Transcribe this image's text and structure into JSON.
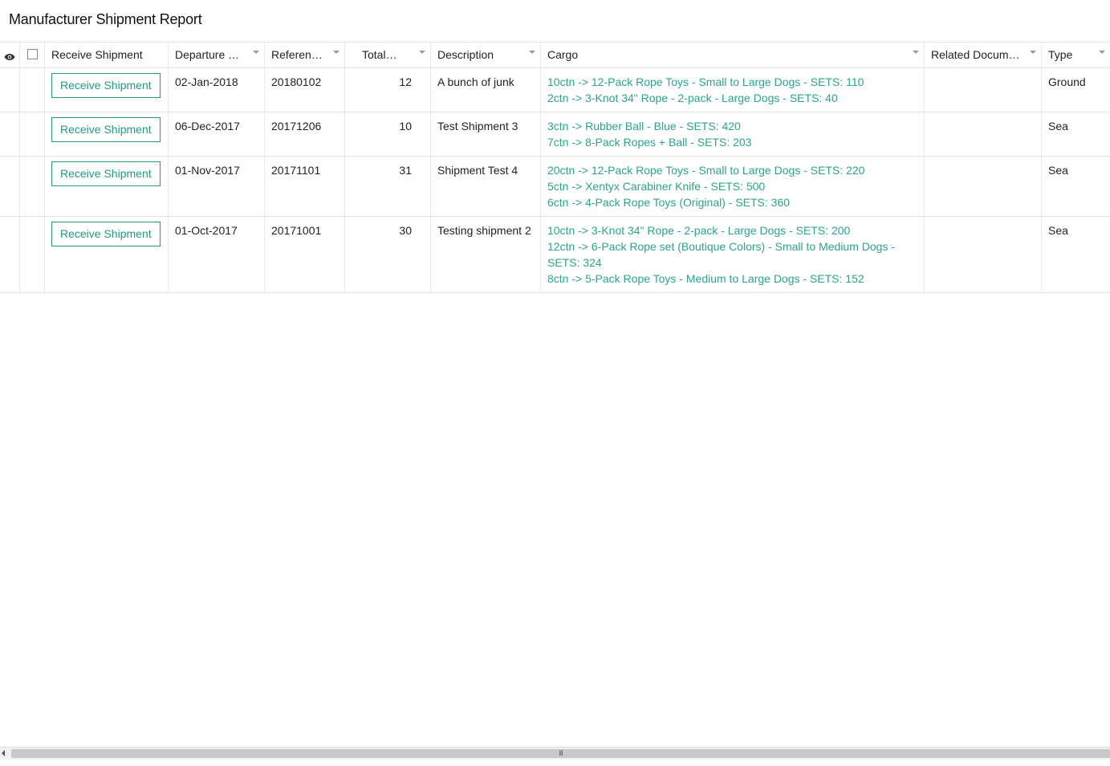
{
  "page": {
    "title": "Manufacturer Shipment Report"
  },
  "columns": {
    "receive": "Receive Shipment",
    "departure": "Departure D...",
    "reference": "Referenc...",
    "total": "Total Ca...",
    "description": "Description",
    "cargo": "Cargo",
    "related": "Related Docume...",
    "type": "Type"
  },
  "rows": [
    {
      "button": "Receive Shipment",
      "departure": "02-Jan-2018",
      "reference": "20180102",
      "total": "12",
      "description": "A bunch of junk",
      "cargo": [
        "10ctn -> 12-Pack Rope Toys - Small to Large Dogs - SETS: 110",
        "2ctn -> 3-Knot 34\" Rope - 2-pack - Large Dogs - SETS: 40"
      ],
      "related": "",
      "type": "Ground"
    },
    {
      "button": "Receive Shipment",
      "departure": "06-Dec-2017",
      "reference": "20171206",
      "total": "10",
      "description": "Test Shipment 3",
      "cargo": [
        "3ctn -> Rubber Ball - Blue - SETS: 420",
        "7ctn -> 8-Pack Ropes + Ball - SETS: 203"
      ],
      "related": "",
      "type": "Sea"
    },
    {
      "button": "Receive Shipment",
      "departure": "01-Nov-2017",
      "reference": "20171101",
      "total": "31",
      "description": "Shipment Test 4",
      "cargo": [
        "20ctn -> 12-Pack Rope Toys - Small to Large Dogs - SETS: 220",
        "5ctn -> Xentyx Carabiner Knife - SETS: 500",
        "6ctn -> 4-Pack Rope Toys (Original) - SETS: 360"
      ],
      "related": "",
      "type": "Sea"
    },
    {
      "button": "Receive Shipment",
      "departure": "01-Oct-2017",
      "reference": "20171001",
      "total": "30",
      "description": "Testing shipment 2",
      "cargo": [
        "10ctn -> 3-Knot 34\" Rope - 2-pack - Large Dogs - SETS: 200",
        "12ctn -> 6-Pack Rope set (Boutique Colors) - Small to Medium Dogs - SETS: 324",
        "8ctn -> 5-Pack Rope Toys - Medium to Large Dogs - SETS: 152"
      ],
      "related": "",
      "type": "Sea"
    }
  ],
  "scrollbar": {
    "grip": "III"
  },
  "icons": {
    "visibility": "eye-icon",
    "select_all": "checkbox-icon"
  },
  "colors": {
    "accent": "#1f9a85",
    "cargo_text": "#2aa48d"
  }
}
